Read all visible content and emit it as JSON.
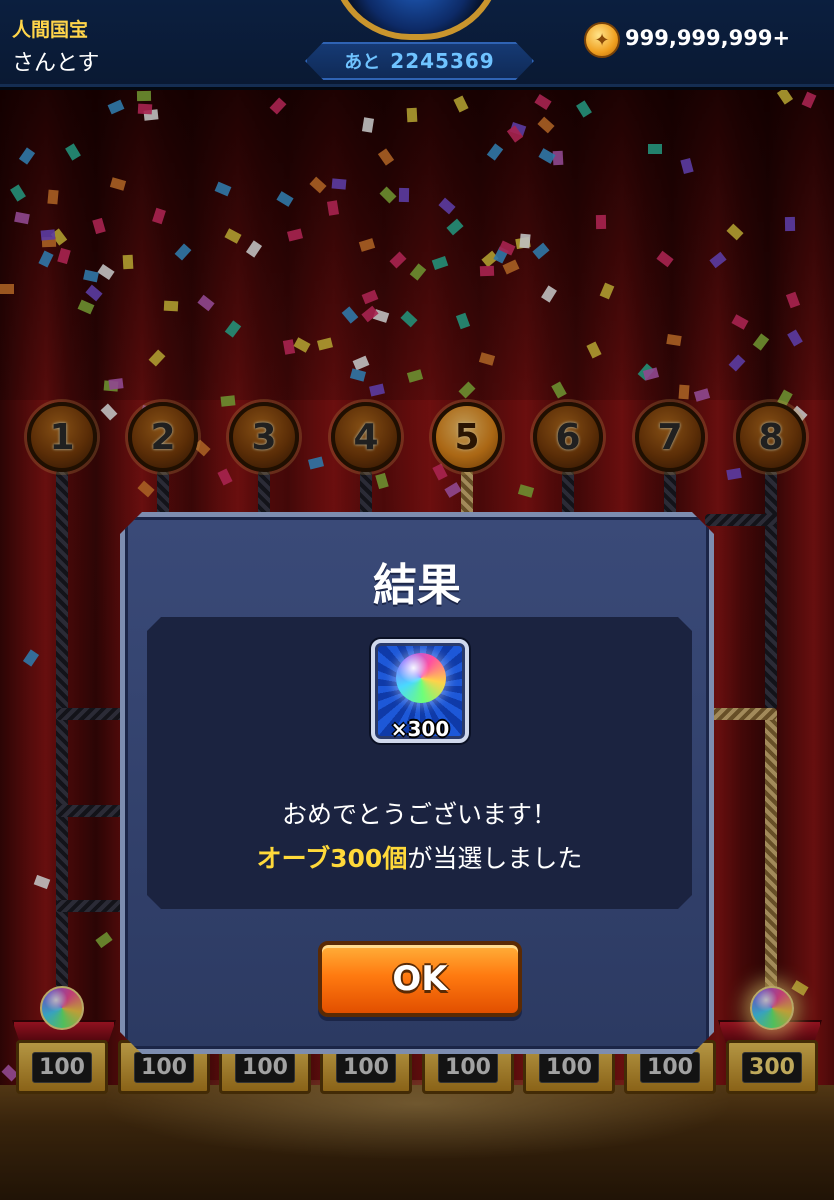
{
  "header": {
    "player_title": "人間国宝",
    "player_name": "さんとす",
    "remaining_prefix": "あと",
    "remaining_value": "2245369",
    "coin_icon": "coin-icon",
    "coin_amount": "999,999,999+"
  },
  "lanes": [
    {
      "number": "1",
      "prize": "100"
    },
    {
      "number": "2",
      "prize": "100"
    },
    {
      "number": "3",
      "prize": "100"
    },
    {
      "number": "4",
      "prize": "100"
    },
    {
      "number": "5",
      "prize": "100"
    },
    {
      "number": "6",
      "prize": "100"
    },
    {
      "number": "7",
      "prize": "100"
    },
    {
      "number": "8",
      "prize": "300"
    }
  ],
  "dialog": {
    "title": "結果",
    "reward_icon": "orb-icon",
    "reward_quantity": "×300",
    "message_line1": "おめでとうございます！",
    "message_highlight": "オーブ300個",
    "message_rest": "が当選しました",
    "ok_label": "OK"
  },
  "colors": {
    "highlight": "#ffd93a",
    "player_title": "#ffd54a",
    "remaining_text": "#6fc3ff",
    "ok_button": "#ff7a10"
  }
}
